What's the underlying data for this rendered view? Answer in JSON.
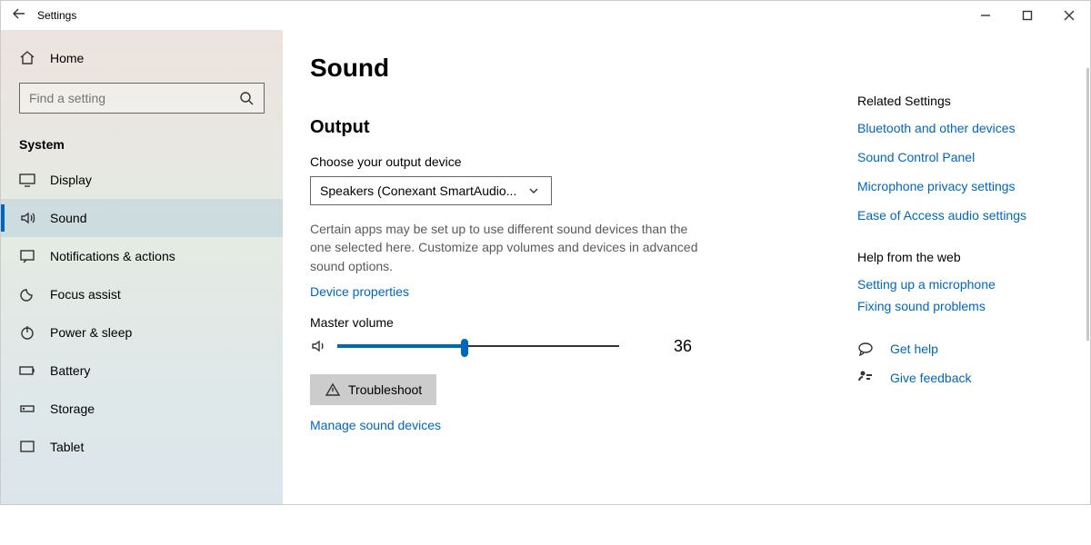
{
  "titlebar": {
    "title": "Settings"
  },
  "sidebar": {
    "home": "Home",
    "search_placeholder": "Find a setting",
    "section": "System",
    "items": [
      {
        "label": "Display"
      },
      {
        "label": "Sound"
      },
      {
        "label": "Notifications & actions"
      },
      {
        "label": "Focus assist"
      },
      {
        "label": "Power & sleep"
      },
      {
        "label": "Battery"
      },
      {
        "label": "Storage"
      },
      {
        "label": "Tablet"
      }
    ]
  },
  "main": {
    "title": "Sound",
    "output_heading": "Output",
    "output_device_label": "Choose your output device",
    "output_device_value": "Speakers (Conexant SmartAudio...",
    "output_note": "Certain apps may be set up to use different sound devices than the one selected here. Customize app volumes and devices in advanced sound options.",
    "device_properties": "Device properties",
    "master_volume_label": "Master volume",
    "master_volume_value": "36",
    "troubleshoot": "Troubleshoot",
    "manage_devices": "Manage sound devices"
  },
  "right": {
    "related_heading": "Related Settings",
    "links": [
      "Bluetooth and other devices",
      "Sound Control Panel",
      "Microphone privacy settings",
      "Ease of Access audio settings"
    ],
    "help_heading": "Help from the web",
    "help_links": [
      "Setting up a microphone",
      "Fixing sound problems"
    ],
    "get_help": "Get help",
    "feedback": "Give feedback"
  }
}
